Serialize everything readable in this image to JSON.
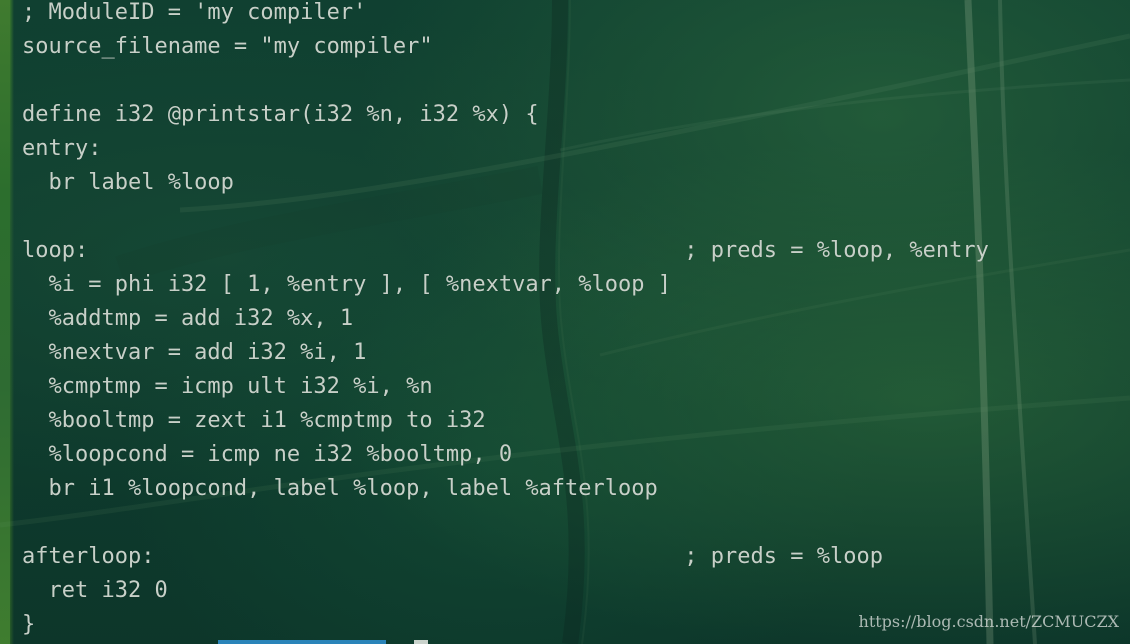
{
  "terminal": {
    "lines": [
      "; ModuleID = 'my compiler'",
      "source_filename = \"my compiler\"",
      "",
      "define i32 @printstar(i32 %n, i32 %x) {",
      "entry:",
      "  br label %loop",
      "",
      "loop:                                             ; preds = %loop, %entry",
      "  %i = phi i32 [ 1, %entry ], [ %nextvar, %loop ]",
      "  %addtmp = add i32 %x, 1",
      "  %nextvar = add i32 %i, 1",
      "  %cmptmp = icmp ult i32 %i, %n",
      "  %booltmp = zext i1 %cmptmp to i32",
      "  %loopcond = icmp ne i32 %booltmp, 0",
      "  br i1 %loopcond, label %loop, label %afterloop",
      "",
      "afterloop:                                        ; preds = %loop",
      "  ret i32 0",
      "}"
    ]
  },
  "watermark": "https://blog.csdn.net/ZCMUCZX",
  "colors": {
    "text": "#c7d0c8",
    "background": "#0f3f31",
    "tab_accent": "#2a84b9"
  }
}
